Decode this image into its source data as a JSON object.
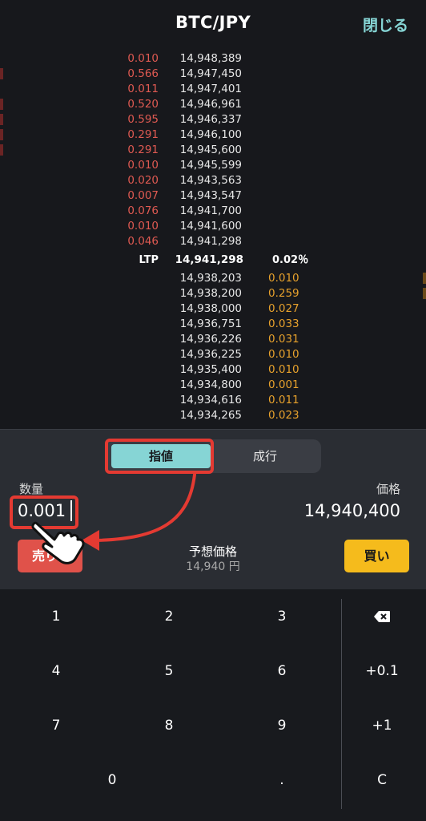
{
  "header": {
    "title": "BTC/JPY",
    "close_label": "閉じる"
  },
  "order_book": {
    "asks": [
      {
        "qty": "0.010",
        "price": "14,948,389"
      },
      {
        "qty": "0.566",
        "price": "14,947,450"
      },
      {
        "qty": "0.011",
        "price": "14,947,401"
      },
      {
        "qty": "0.520",
        "price": "14,946,961"
      },
      {
        "qty": "0.595",
        "price": "14,946,337"
      },
      {
        "qty": "0.291",
        "price": "14,946,100"
      },
      {
        "qty": "0.291",
        "price": "14,945,600"
      },
      {
        "qty": "0.010",
        "price": "14,945,599"
      },
      {
        "qty": "0.020",
        "price": "14,943,563"
      },
      {
        "qty": "0.007",
        "price": "14,943,547"
      },
      {
        "qty": "0.076",
        "price": "14,941,700"
      },
      {
        "qty": "0.010",
        "price": "14,941,600"
      },
      {
        "qty": "0.046",
        "price": "14,941,298"
      }
    ],
    "ltp": {
      "label": "LTP",
      "price": "14,941,298",
      "change": "0.02％"
    },
    "bids": [
      {
        "price": "14,938,203",
        "qty": "0.010"
      },
      {
        "price": "14,938,200",
        "qty": "0.259"
      },
      {
        "price": "14,938,000",
        "qty": "0.027"
      },
      {
        "price": "14,936,751",
        "qty": "0.033"
      },
      {
        "price": "14,936,226",
        "qty": "0.031"
      },
      {
        "price": "14,936,225",
        "qty": "0.010"
      },
      {
        "price": "14,935,400",
        "qty": "0.010"
      },
      {
        "price": "14,934,800",
        "qty": "0.001"
      },
      {
        "price": "14,934,616",
        "qty": "0.011"
      },
      {
        "price": "14,934,265",
        "qty": "0.023"
      }
    ]
  },
  "order_form": {
    "order_types": [
      "指値",
      "成行"
    ],
    "selected_type": "指値",
    "quantity_label": "数量",
    "quantity_value": "0.001",
    "price_label": "価格",
    "price_value": "14,940,400",
    "sell_label": "売り",
    "buy_label": "買い",
    "estimate_label": "予想価格",
    "estimate_value": "14,940 円"
  },
  "keypad": {
    "keys": [
      "1",
      "2",
      "3",
      "4",
      "5",
      "6",
      "7",
      "8",
      "9",
      "0",
      "."
    ],
    "side_keys": [
      "backspace-icon",
      "+0.1",
      "+1",
      "C"
    ]
  },
  "colors": {
    "accent": "#86d5d5",
    "ask": "#e05a52",
    "bid": "#e7a12c",
    "buy": "#f5bb1c",
    "sell": "#e0524a",
    "highlight": "#e43a32"
  }
}
